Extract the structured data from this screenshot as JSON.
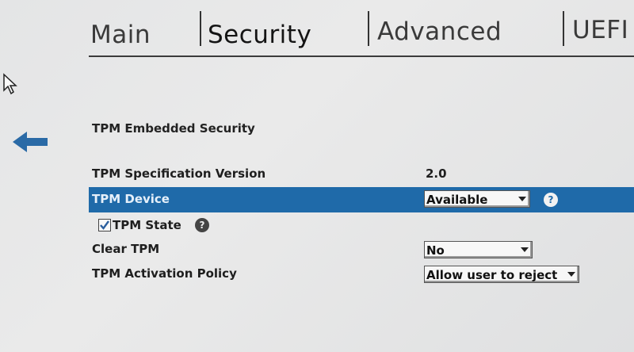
{
  "tabs": [
    {
      "label": "Main"
    },
    {
      "label": "Security"
    },
    {
      "label": "Advanced"
    },
    {
      "label": "UEFI"
    }
  ],
  "section": {
    "title": "TPM Embedded Security"
  },
  "rows": {
    "spec_version": {
      "label": "TPM Specification Version",
      "value": "2.0"
    },
    "device": {
      "label": "TPM Device",
      "value": "Available"
    },
    "state": {
      "label": "TPM State",
      "checked": true
    },
    "clear": {
      "label": "Clear TPM",
      "value": "No"
    },
    "activation": {
      "label": "TPM Activation Policy",
      "value": "Allow user to reject"
    }
  },
  "help_glyph": "?",
  "colors": {
    "highlight": "#1f6aa9",
    "back_arrow": "#2a6aa6"
  },
  "icons": {
    "back": "arrow-left-icon",
    "help": "help-icon",
    "cursor": "mouse-pointer-icon"
  }
}
